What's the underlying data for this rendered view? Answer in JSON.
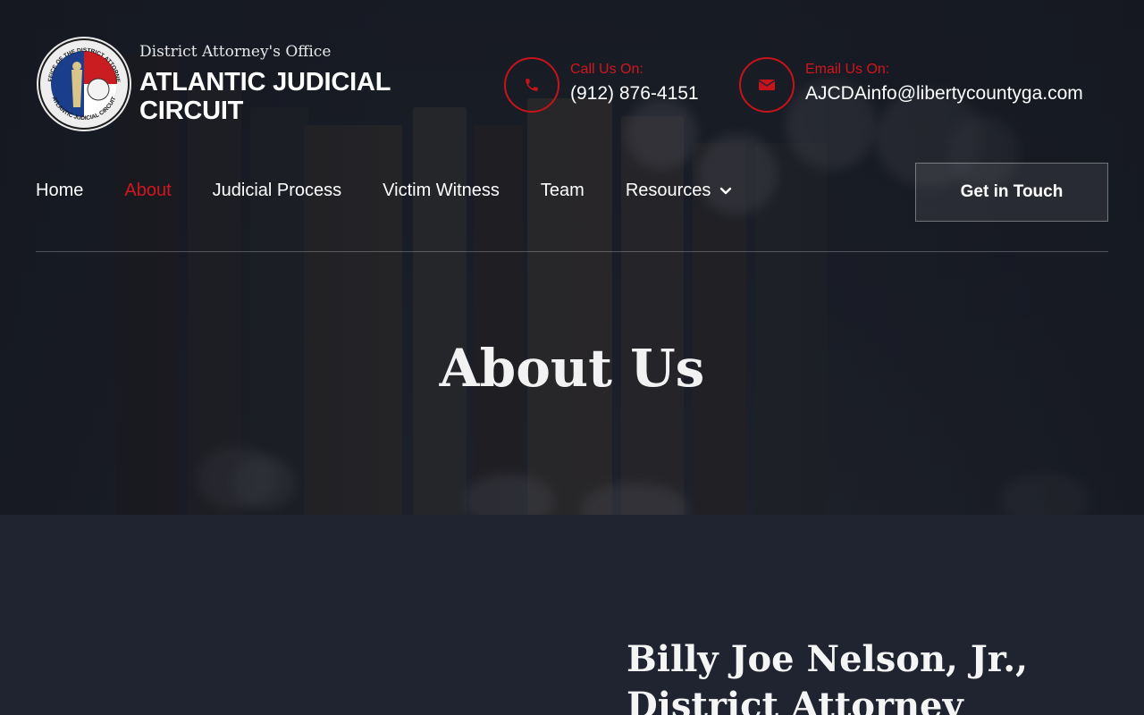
{
  "brand": {
    "subtitle": "District Attorney's Office",
    "name_line1": "ATLANTIC JUDICIAL",
    "name_line2": "CIRCUIT",
    "seal_text_top": "OFFICE OF THE DISTRICT ATTORNEY",
    "seal_text_bottom": "ATLANTIC JUDICIAL CIRCUIT"
  },
  "contact": {
    "phone_label": "Call Us On:",
    "phone_value": "(912) 876-4151",
    "email_label": "Email Us On:",
    "email_value": "AJCDAinfo@libertycountyga.com"
  },
  "nav": {
    "items": [
      {
        "label": "Home"
      },
      {
        "label": "About",
        "active": true
      },
      {
        "label": "Judicial Process"
      },
      {
        "label": "Victim Witness"
      },
      {
        "label": "Team"
      },
      {
        "label": "Resources",
        "has_dropdown": true
      }
    ],
    "cta_label": "Get in Touch"
  },
  "hero": {
    "title": "About Us"
  },
  "profile": {
    "name": "Billy Joe Nelson, Jr.,",
    "role": "District Attorney"
  },
  "icons": {
    "phone": "phone-icon",
    "email": "email-icon",
    "dropdown": "chevron-down-icon"
  },
  "colors": {
    "accent_red": "#d2161e",
    "page_bg": "#1f2430",
    "text": "#ffffff"
  }
}
